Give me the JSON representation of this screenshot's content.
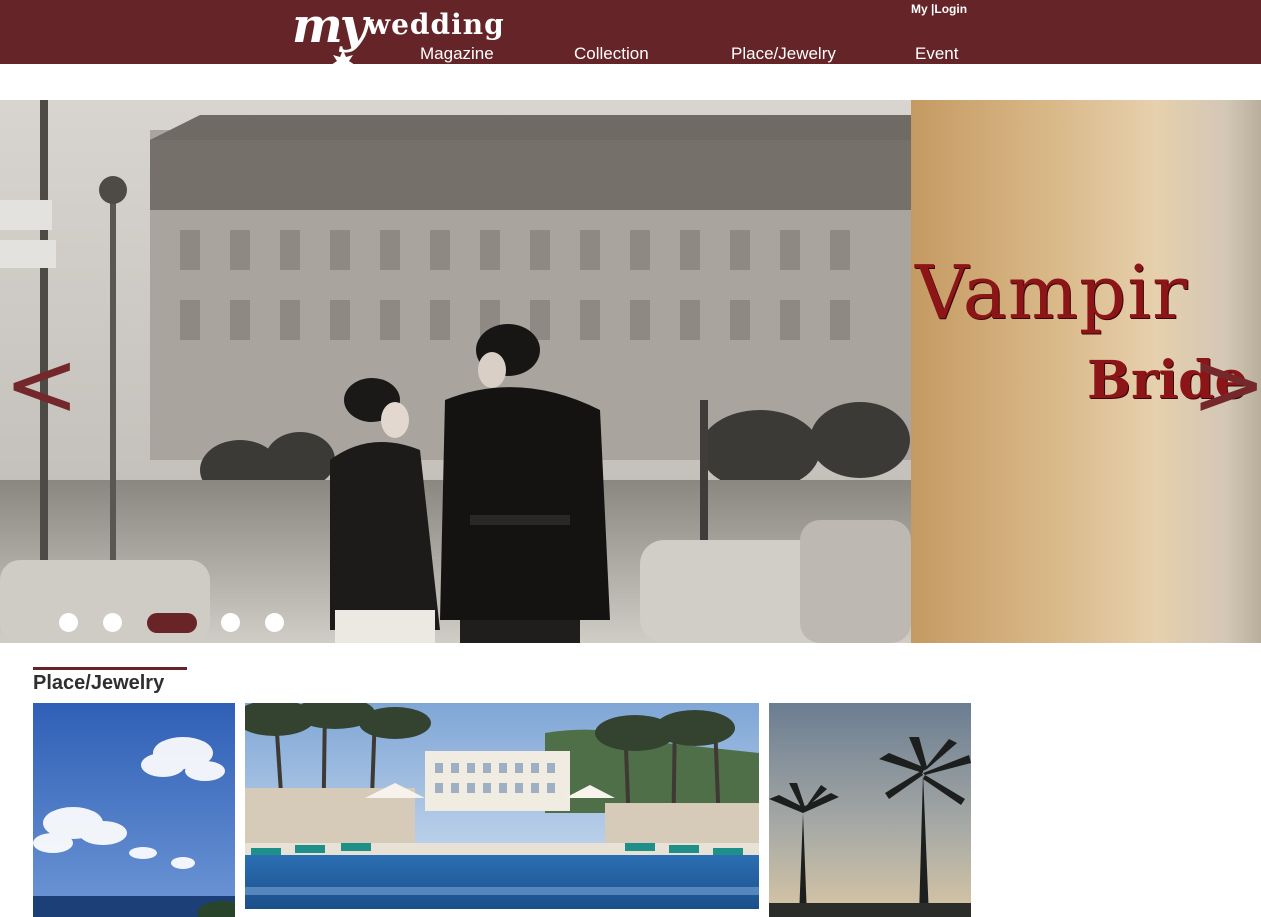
{
  "header": {
    "logo": {
      "my": "my",
      "wedding": "wedding"
    },
    "nav": [
      {
        "label": "Magazine"
      },
      {
        "label": "Collection"
      },
      {
        "label": "Place/Jewelry"
      },
      {
        "label": "Event"
      }
    ],
    "account": {
      "my": "My",
      "separator": "|",
      "login": "Login"
    }
  },
  "slider": {
    "next_slide": {
      "title": "Vampir",
      "subtitle": "Bride"
    },
    "prev_arrow": "<",
    "next_arrow": ">",
    "slide_count": 5,
    "active_index": 2
  },
  "section": {
    "title": "Place/Jewelry"
  },
  "colors": {
    "brand": "#652427",
    "dot_active": "#692427",
    "dot_inactive": "#ffffff"
  }
}
